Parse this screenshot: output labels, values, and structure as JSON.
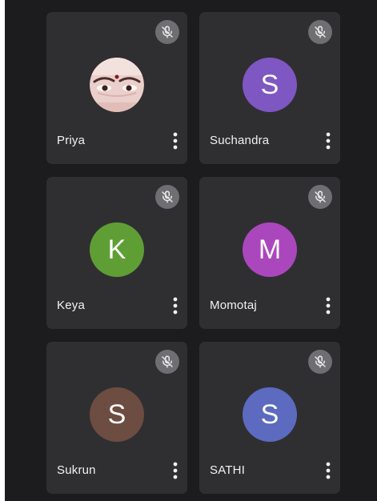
{
  "participants": [
    {
      "name": "Priya",
      "initial": "",
      "avatar_type": "photo",
      "avatar_color": "#e7c9c6",
      "mic_muted": true
    },
    {
      "name": "Suchandra",
      "initial": "S",
      "avatar_type": "letter",
      "avatar_color": "#7e57c2",
      "mic_muted": true
    },
    {
      "name": "Keya",
      "initial": "K",
      "avatar_type": "letter",
      "avatar_color": "#5f9e35",
      "mic_muted": true
    },
    {
      "name": "Momotaj",
      "initial": "M",
      "avatar_type": "letter",
      "avatar_color": "#ab47bc",
      "mic_muted": true
    },
    {
      "name": "Sukrun",
      "initial": "S",
      "avatar_type": "letter",
      "avatar_color": "#6d4c41",
      "mic_muted": true
    },
    {
      "name": "SATHI",
      "initial": "S",
      "avatar_type": "letter",
      "avatar_color": "#5c6bc0",
      "mic_muted": true
    }
  ],
  "icons": {
    "mic": "mic-off-icon",
    "more": "more-vert-icon"
  },
  "colors": {
    "background": "#1c1c1e",
    "tile": "#2f2f32",
    "mic_badge": "#6f6f73"
  }
}
